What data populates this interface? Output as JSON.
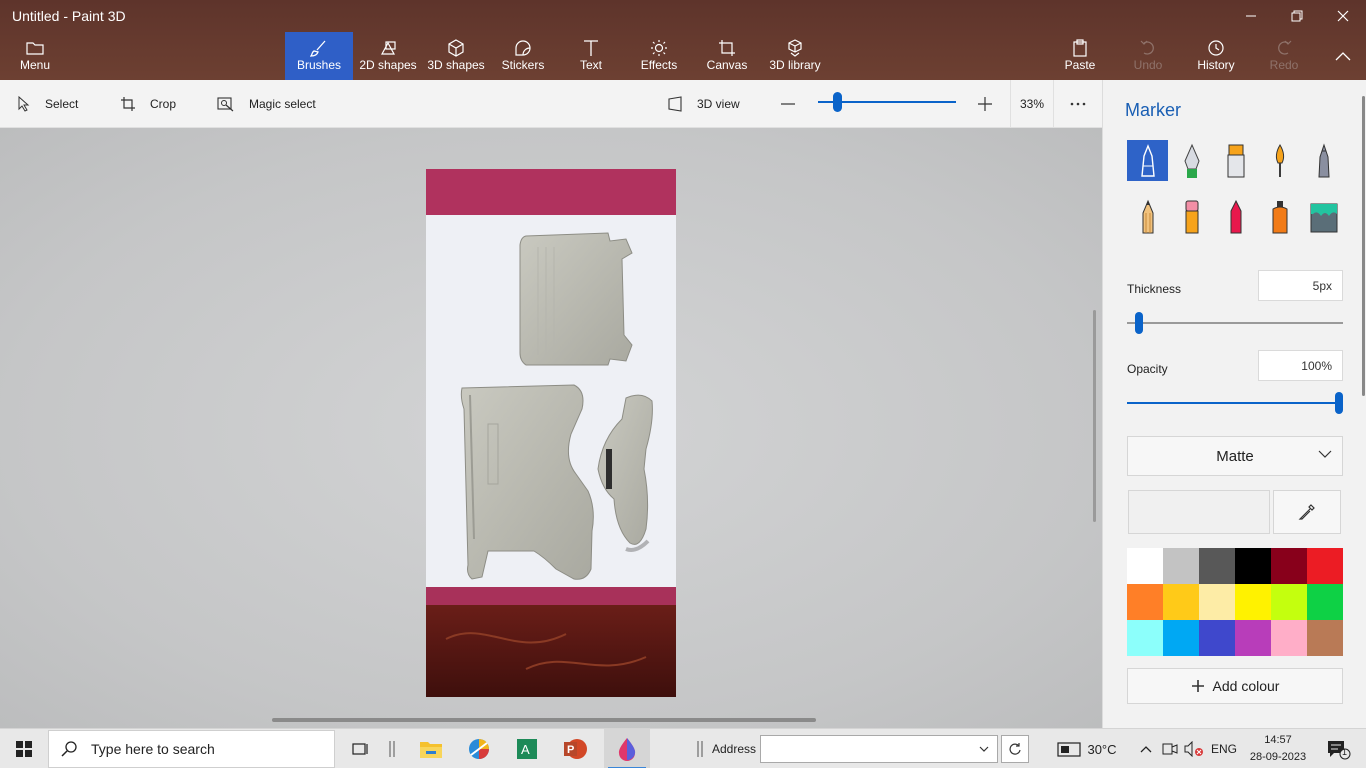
{
  "window": {
    "title": "Untitled - Paint 3D"
  },
  "ribbon": {
    "menu": "Menu",
    "brushes": "Brushes",
    "shapes2d": "2D shapes",
    "shapes3d": "3D shapes",
    "stickers": "Stickers",
    "text": "Text",
    "effects": "Effects",
    "canvas": "Canvas",
    "library3d": "3D library",
    "paste": "Paste",
    "undo": "Undo",
    "history": "History",
    "redo": "Redo"
  },
  "toolbar": {
    "select": "Select",
    "crop": "Crop",
    "magic_select": "Magic select",
    "view3d": "3D view",
    "zoom_level": 0.33,
    "zoom": "33%"
  },
  "panel": {
    "title": "Marker",
    "thickness_label": "Thickness",
    "thickness_value": "5px",
    "opacity_label": "Opacity",
    "opacity_value": "100%",
    "finish": "Matte",
    "add_colour": "Add colour",
    "brushes": [
      "marker",
      "calligraphy-pen",
      "oil-brush",
      "watercolor",
      "pixel-pen",
      "pencil",
      "eraser",
      "crayon",
      "spray-can",
      "fill"
    ],
    "palette": [
      "#ffffff",
      "#c3c3c3",
      "#585858",
      "#000000",
      "#88001b",
      "#ec1c24",
      "#ff7f27",
      "#ffca18",
      "#fdeca6",
      "#fff200",
      "#c4ff0e",
      "#0ed145",
      "#8cfffb",
      "#00a8f3",
      "#3f48cc",
      "#b83dba",
      "#ffaec8",
      "#b97a56"
    ]
  },
  "taskbar": {
    "search_placeholder": "Type here to search",
    "address_label": "Address",
    "temperature": "30°C",
    "language": "ENG",
    "time": "14:57",
    "date": "28-09-2023",
    "notification_count": "1"
  },
  "colors": {
    "accent": "#2f5fc7",
    "ribbon_bg": "#6a3d30",
    "slider": "#0a63c9"
  }
}
